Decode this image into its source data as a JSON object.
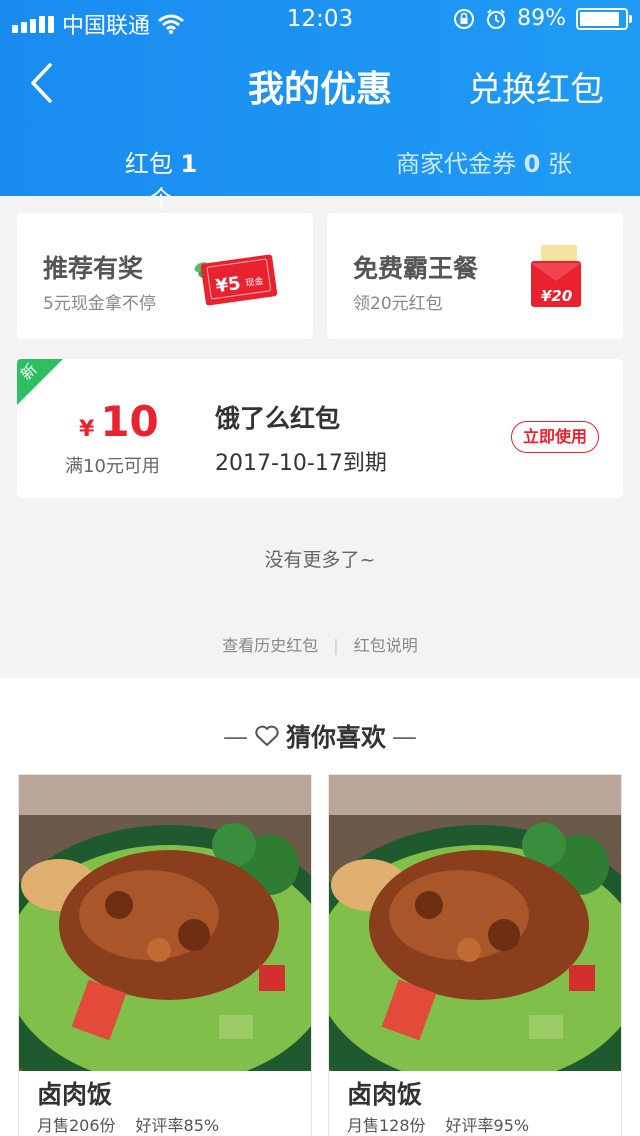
{
  "status_bar": {
    "carrier": "中国联通",
    "time": "12:03",
    "battery": "89%",
    "battery_level": 0.89
  },
  "nav": {
    "title": "我的优惠",
    "action": "兑换红包"
  },
  "tabs": [
    {
      "label": "红包",
      "count": "1",
      "unit": "个"
    },
    {
      "label": "商家代金券",
      "count": "0",
      "unit": "张"
    }
  ],
  "promos": [
    {
      "title": "推荐有奖",
      "subtitle": "5元现金拿不停",
      "badge": "¥5",
      "badge_small": "现金"
    },
    {
      "title": "免费霸王餐",
      "subtitle": "领20元红包",
      "badge": "¥20"
    }
  ],
  "coupon": {
    "tag": "新",
    "currency": "¥",
    "amount": "10",
    "condition": "满10元可用",
    "name": "饿了么红包",
    "expiry": "2017-10-17到期",
    "action": "立即使用"
  },
  "no_more": "没有更多了~",
  "links": {
    "history": "查看历史红包",
    "divider": "|",
    "help": "红包说明"
  },
  "recommend": {
    "title": "猜你喜欢",
    "items": [
      {
        "name": "卤肉饭",
        "sales": "月售206份",
        "rating": "好评率85%"
      },
      {
        "name": "卤肉饭",
        "sales": "月售128份",
        "rating": "好评率95%"
      }
    ]
  },
  "colors": {
    "brand_blue": "#1a8cf0",
    "accent_red": "#e8222e",
    "new_green": "#2fbf63"
  },
  "icons": [
    "signal-icon",
    "wifi-icon",
    "rotation-lock-icon",
    "alarm-icon",
    "battery-icon",
    "back-icon",
    "heart-icon"
  ]
}
